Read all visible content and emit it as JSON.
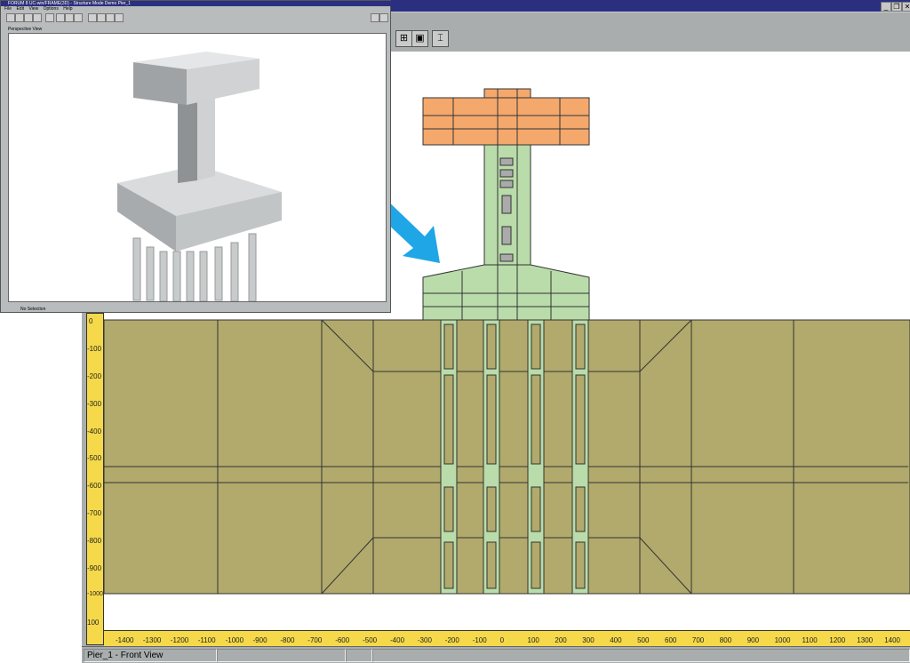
{
  "main_window": {
    "window_buttons": [
      "_",
      "❐",
      "✕"
    ],
    "toolbar_icons": [
      "fit-view-icon",
      "frame-view-icon",
      "pier-icon"
    ],
    "status": {
      "view_name": "Pier_1 - Front View"
    }
  },
  "rulers": {
    "horizontal": [
      "-1400",
      "-1300",
      "-1200",
      "-1100",
      "-1000",
      "-900",
      "-800",
      "-700",
      "-600",
      "-500",
      "-400",
      "-300",
      "-200",
      "-100",
      "0",
      "100",
      "200",
      "300",
      "400",
      "500",
      "600",
      "700",
      "800",
      "900",
      "1000",
      "1100",
      "1200",
      "1300",
      "1400"
    ],
    "vertical": [
      "0",
      "-100",
      "-200",
      "-300",
      "-400",
      "-500",
      "-600",
      "-700",
      "-800",
      "-900",
      "-1000",
      "100"
    ]
  },
  "inset_window": {
    "title": "FORUM 8   UC-win/FRAME(3D) - Structure Mode   Demo   Pier_1",
    "menu": [
      "File",
      "Edit",
      "View",
      "Options",
      "Help"
    ],
    "view_label": "Perspective View",
    "status": "No Selection"
  },
  "colors": {
    "cap": "#f4a86c",
    "pier": "#b9dcaa",
    "footing": "#b1aa6c",
    "arrow": "#1fa6e6",
    "ruler": "#f5d94a"
  }
}
